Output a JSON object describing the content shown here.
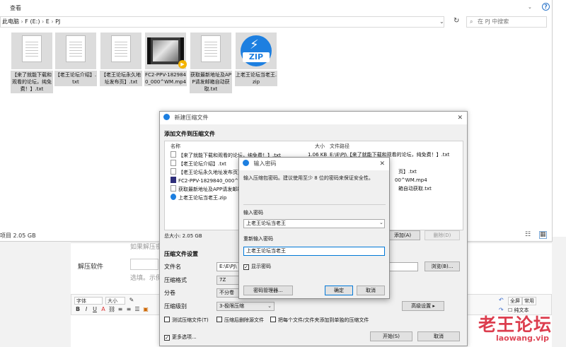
{
  "explorer": {
    "ribbon_tab": "查看",
    "breadcrumb": [
      "此电脑",
      "F (E:)",
      "E",
      "PJ"
    ],
    "search_placeholder": "在 PJ 中搜索",
    "files": [
      {
        "name": "【来了就能下载和观看的论坛，纯免费！】.txt",
        "type": "txt"
      },
      {
        "name": "【老王论坛介绍】.txt",
        "type": "txt"
      },
      {
        "name": "【老王论坛永久地址发布页】.txt",
        "type": "txt"
      },
      {
        "name": "FC2-PPV-1829840_000^WM.mp4",
        "type": "video"
      },
      {
        "name": "获取最新地址及APP请发邮箱自动获取.txt",
        "type": "txt"
      },
      {
        "name": "上老王论坛当老王.zip",
        "type": "zip"
      }
    ],
    "status_size": "2.05 GB",
    "status_prefix": "项目"
  },
  "archive_dialog": {
    "title": "新建压缩文件",
    "add_section": "添加文件到压缩文件",
    "columns": {
      "name": "名称",
      "size": "大小",
      "path": "文件路径"
    },
    "rows": [
      {
        "name": "【来了就能下载和观看的论坛，纯免费！】.txt",
        "size": "1.06 KB",
        "path": "E:\\E\\PJ\\【来了就能下载和观看的论坛，纯免费！】.txt",
        "icon": "txt"
      },
      {
        "name": "【老王论坛介绍】.txt",
        "size": "",
        "path": "",
        "icon": "txt"
      },
      {
        "name": "【老王论坛永久地址发布页】.txt",
        "size": "",
        "path": "页】.txt",
        "icon": "txt"
      },
      {
        "name": "FC2-PPV-1829840_000^WM.mp4",
        "size": "",
        "path": "00^WM.mp4",
        "icon": "video"
      },
      {
        "name": "获取最新地址及APP请发邮箱自动获取.txt",
        "size": "",
        "path": "箱自动获取.txt",
        "icon": "txt"
      },
      {
        "name": "上老王论坛当老王.zip",
        "size": "",
        "path": "",
        "icon": "zip"
      }
    ],
    "total_size": "总大小: 2.05 GB",
    "add_button": "添加(A)",
    "delete_button": "删除(D)",
    "settings_section": "压缩文件设置",
    "filename_label": "文件名",
    "filename_value": "E:\\E\\PJ\\",
    "browse_button": "浏览(B)...",
    "format_label": "压缩格式",
    "format_value": "7Z",
    "split_label": "分卷",
    "split_value": "不分卷",
    "level_label": "压缩级别",
    "level_value": "3-极限压缩",
    "advanced_button": "高级设置 ▸",
    "test_checkbox": "测试压缩文件(T)",
    "delete_source_checkbox": "压缩后删除源文件",
    "separate_checkbox": "把每个文件/文件夹添加到单独的压缩文件",
    "more_options": "更多选项...",
    "start_button": "开始(S)",
    "cancel_button": "取消"
  },
  "password_dialog": {
    "title": "输入密码",
    "hint": "输入压缩包密码。建议使用至少 8 位的密码来保证安全性。",
    "enter_label": "输入密码",
    "enter_value": "上老王论坛当老王",
    "reenter_label": "重新输入密码",
    "reenter_value": "上老王论坛当老王",
    "show_password": "显示密码",
    "manager_button": "密码管理器...",
    "ok_button": "确定",
    "cancel_button": "取消"
  },
  "webpage": {
    "hint1": "如果解压密",
    "label_unzip": "解压软件",
    "hint2": "选填。示例",
    "editor_font": "字体",
    "editor_size": "大小",
    "fullscreen": "全屏",
    "help": "常用",
    "plain_text": "纯文本"
  },
  "watermark": {
    "text": "老王论坛",
    "url": "laowang.vip"
  },
  "colors": {
    "accent": "#0078d7",
    "zip_blue": "#1d7fe0",
    "watermark": "#d9293b"
  }
}
